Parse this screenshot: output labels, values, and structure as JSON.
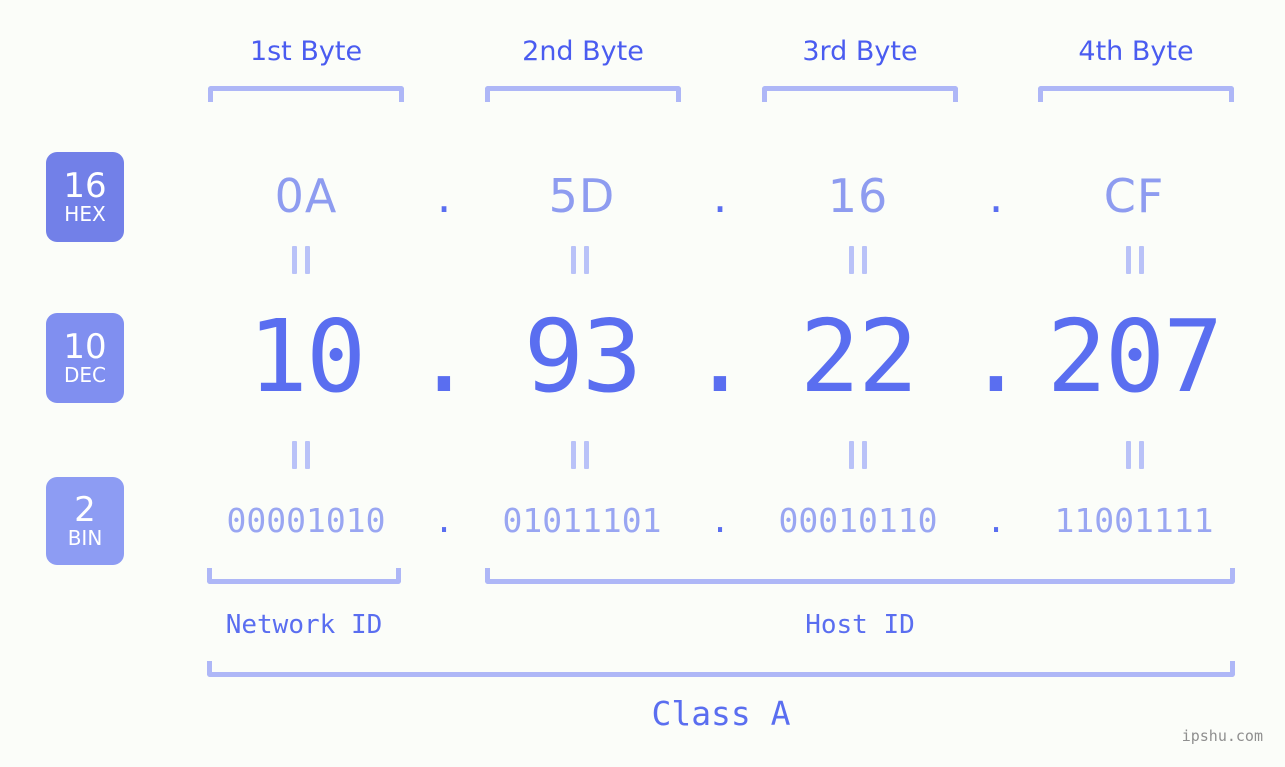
{
  "meta": {
    "ip_address": "10.93.22.207",
    "ip_class": "Class A",
    "watermark": "ipshu.com"
  },
  "headers": [
    {
      "label": "1st Byte"
    },
    {
      "label": "2nd Byte"
    },
    {
      "label": "3rd Byte"
    },
    {
      "label": "4th Byte"
    }
  ],
  "rows": {
    "hex": {
      "badge_base": "16",
      "badge_name": "HEX",
      "badge_color": "#7280e8",
      "values": [
        "0A",
        "5D",
        "16",
        "CF"
      ],
      "separator": "."
    },
    "dec": {
      "badge_base": "10",
      "badge_name": "DEC",
      "badge_color": "#808ff0",
      "values": [
        "10",
        "93",
        "22",
        "207"
      ],
      "separator": "."
    },
    "bin": {
      "badge_base": "2",
      "badge_name": "BIN",
      "badge_color": "#8d9cf3",
      "values": [
        "00001010",
        "01011101",
        "00010110",
        "11001111"
      ],
      "separator": "."
    }
  },
  "equals_symbol": "=",
  "footer": {
    "network_id_label": "Network ID",
    "host_id_label": "Host ID",
    "class_label": "Class A"
  },
  "colors": {
    "background": "#fbfdf9",
    "header_text": "#4a5cf0",
    "bracket": "#aeb7f7",
    "hex_value": "#8e9cf0",
    "dec_value": "#5a6ef0",
    "bin_value": "#99a6f2",
    "equals": "#b9c2f8",
    "watermark": "#8f8f8f"
  }
}
